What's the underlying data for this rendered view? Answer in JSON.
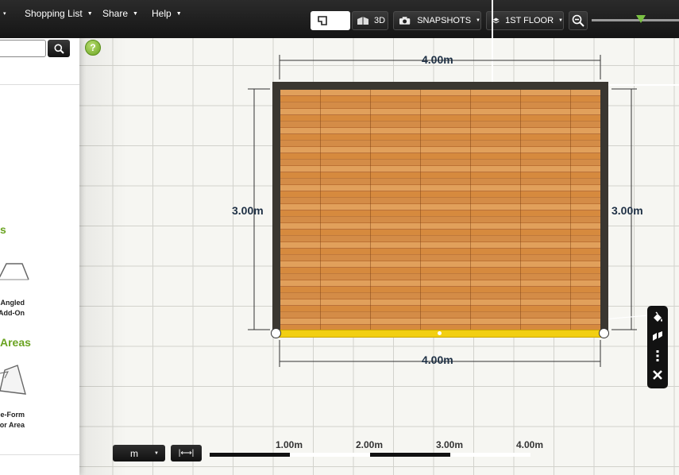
{
  "menu": {
    "items": [
      {
        "label": "Shopping List"
      },
      {
        "label": "Share"
      },
      {
        "label": "Help"
      }
    ],
    "edge_caret": "▾"
  },
  "toolbar": {
    "view_3d_label": "3D",
    "snapshots_label": "SNAPSHOTS",
    "floor_label": "1ST FLOOR",
    "zoom_level": 0.55
  },
  "left_panel": {
    "search_placeholder": "",
    "section_1_heading": "s",
    "tile_1_line1": "Angled",
    "tile_1_line2": "Add-On",
    "section_2_heading": "Areas",
    "tile_2_line1": "ee-Form",
    "tile_2_line2": "oor Area"
  },
  "help_label": "?",
  "room": {
    "top_dimension": "4.00m",
    "bottom_dimension": "4.00m",
    "left_dimension": "3.00m",
    "right_dimension": "3.00m"
  },
  "bottom": {
    "units_value": "m",
    "measure_icon_label": "|⟷|",
    "scale_labels": [
      "1.00m",
      "2.00m",
      "3.00m",
      "4.00m"
    ]
  },
  "colors": {
    "accent_green": "#6aa321",
    "selected_wall": "#f2cf12",
    "wall": "#3a3731"
  }
}
